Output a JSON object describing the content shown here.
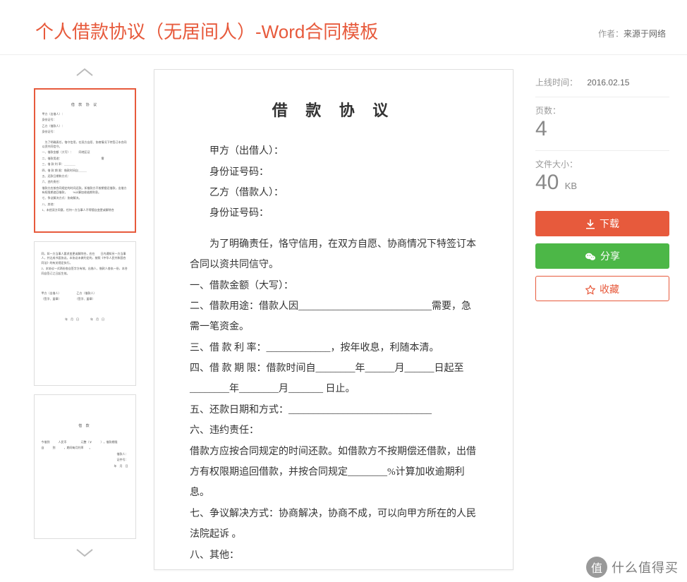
{
  "header": {
    "title": "个人借款协议（无居间人）-Word合同模板",
    "author_label": "作者：",
    "author_value": "来源于网络"
  },
  "meta": {
    "online_time_label": "上线时间：",
    "online_time_value": "2016.02.15",
    "pages_label": "页数：",
    "pages_value": "4",
    "filesize_label": "文件大小：",
    "filesize_value": "40",
    "filesize_unit": "KB"
  },
  "actions": {
    "download": "下载",
    "share": "分享",
    "favorite": "收藏"
  },
  "thumbs": {
    "t1": {
      "title": "借 款 协 议"
    },
    "t3": {
      "title": "借  款"
    }
  },
  "doc": {
    "title": "借 款 协 议",
    "l1": "甲方（出借人）：",
    "l2": "身份证号码：",
    "l3": "乙方（借款人）：",
    "l4": "身份证号码：",
    "p1": "为了明确责任，恪守信用，在双方自愿、协商情况下特签订本合同以资共同信守。",
    "p2": "一、借款金额（大写）：",
    "p3": "二、借款用途：借款人因___________________________需要，急需一笔资金。",
    "p4": "三、借 款 利 率：_____________，按年收息，利随本清。",
    "p5": "四、借 款 期 限：借款时间自________年______月______日起至________年________月_______ 日止。",
    "p6": "五、还款日期和方式：_____________________________",
    "p7": "六、违约责任：",
    "p8": "借款方应按合同规定的时间还款。如借款方不按期偿还借款，出借方有权限期追回借款，并按合同规定________%计算加收逾期利息。",
    "p9": "七、争议解决方式：协商解决，协商不成，可以向甲方所在的人民法院起诉 。",
    "p10": "八、其他：",
    "p11": "1、未经双方同意，任何一方当事人不得擅自变更或解除合"
  },
  "watermark": {
    "char": "值",
    "text": "什么值得买"
  }
}
